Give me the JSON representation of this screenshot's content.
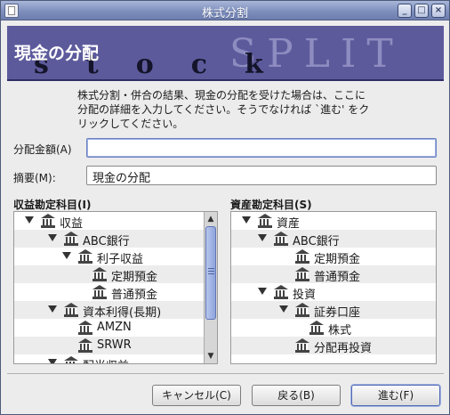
{
  "window": {
    "title": "株式分割",
    "controls": {
      "minimize": "_",
      "maximize": "□",
      "close": "×"
    }
  },
  "banner": {
    "title": "現金の分配",
    "watermark": "SPLIT",
    "subtitle": "stock",
    "bg_color": "#5d5a9c"
  },
  "description": "株式分割・併合の結果、現金の分配を受けた場合は、ここに分配の詳細を入力してください。そうでなければ `進む' をクリックしてください。",
  "form": {
    "amount_label": "分配金額(A)",
    "amount_value": "",
    "memo_label": "摘要(M):",
    "memo_value": "現金の分配"
  },
  "income_tree": {
    "heading": "収益勘定科目(I)",
    "rows": [
      {
        "label": "収益",
        "expanded": true
      },
      {
        "label": "ABC銀行",
        "expanded": true
      },
      {
        "label": "利子収益",
        "expanded": true
      },
      {
        "label": "定期預金"
      },
      {
        "label": "普通預金"
      },
      {
        "label": "資本利得(長期)",
        "expanded": true
      },
      {
        "label": "AMZN"
      },
      {
        "label": "SRWR"
      },
      {
        "label": "配当収益",
        "expanded": true
      }
    ]
  },
  "asset_tree": {
    "heading": "資産勘定科目(S)",
    "rows": [
      {
        "label": "資産",
        "expanded": true
      },
      {
        "label": "ABC銀行",
        "expanded": true
      },
      {
        "label": "定期預金"
      },
      {
        "label": "普通預金"
      },
      {
        "label": "投資",
        "expanded": true
      },
      {
        "label": "証券口座",
        "expanded": true
      },
      {
        "label": "株式"
      },
      {
        "label": "分配再投資"
      }
    ]
  },
  "buttons": {
    "cancel": "キャンセル(C)",
    "back": "戻る(B)",
    "forward": "進む(F)"
  },
  "icons": {
    "account": "bank-building-icon",
    "expander": "triangle-down-icon"
  }
}
